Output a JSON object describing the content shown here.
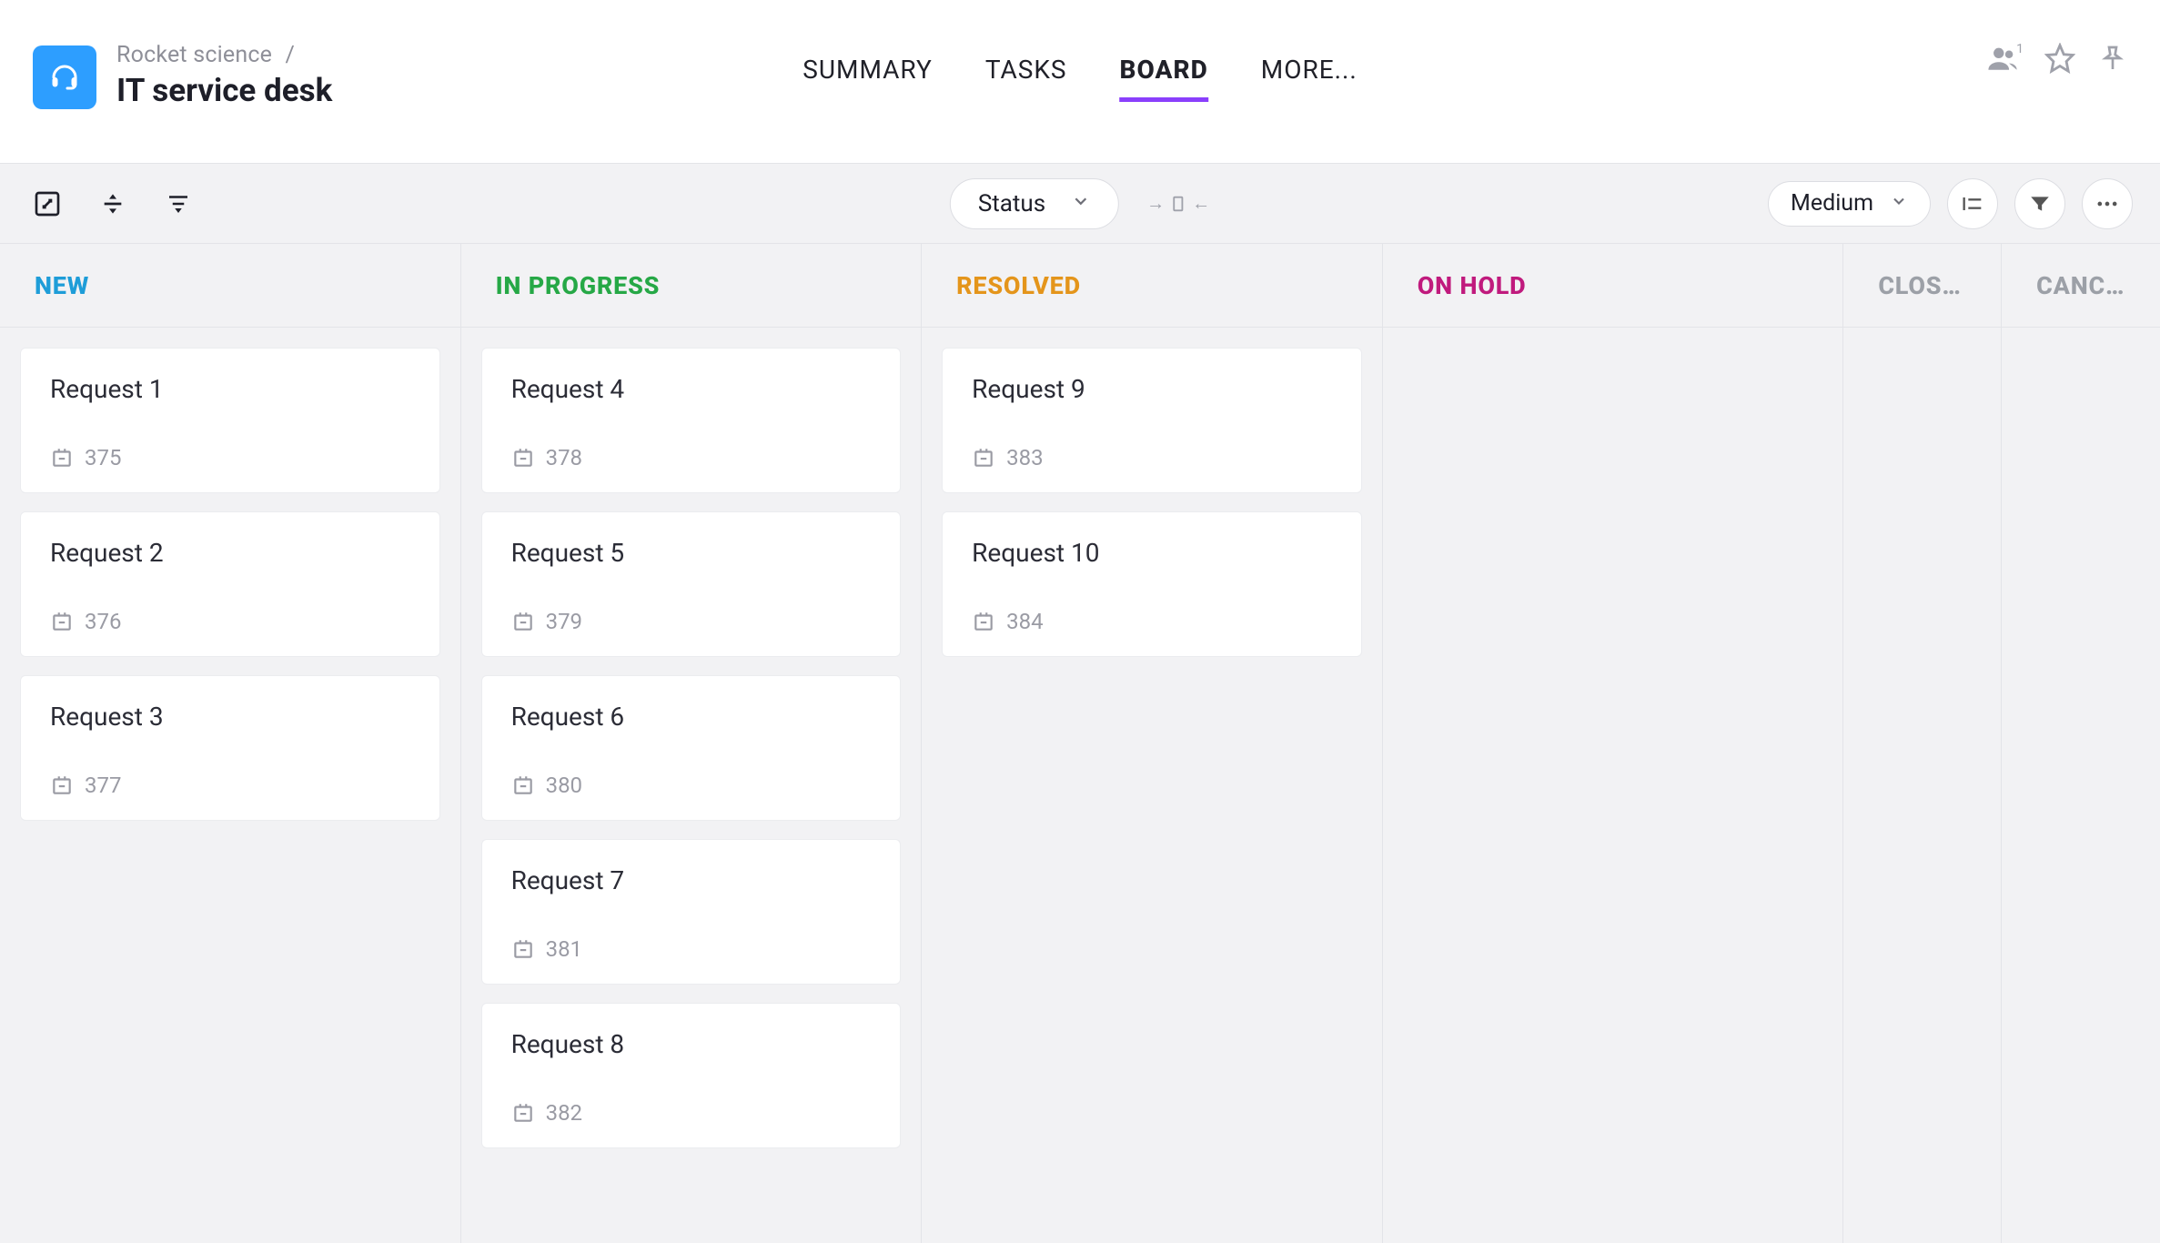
{
  "breadcrumb": {
    "parent": "Rocket science",
    "sep": "/"
  },
  "title": "IT service desk",
  "tabs": {
    "summary": "SUMMARY",
    "tasks": "TASKS",
    "board": "BOARD",
    "more": "MORE..."
  },
  "active_tab": "board",
  "header_actions": {
    "members_count": "1"
  },
  "toolbar": {
    "group_by": "Status",
    "size": "Medium"
  },
  "columns": [
    {
      "key": "new",
      "label": "NEW",
      "colorClass": "c-new",
      "widthClass": "w-big"
    },
    {
      "key": "inprog",
      "label": "IN PROGRESS",
      "colorClass": "c-inprog",
      "widthClass": "w-big"
    },
    {
      "key": "resolved",
      "label": "RESOLVED",
      "colorClass": "c-resolved",
      "widthClass": "w-big"
    },
    {
      "key": "onhold",
      "label": "ON HOLD",
      "colorClass": "c-onhold",
      "widthClass": "w-big"
    },
    {
      "key": "closed",
      "label": "CLOS…",
      "colorClass": "c-closed",
      "widthClass": "w-narrow"
    },
    {
      "key": "cancelled",
      "label": "CANC…",
      "colorClass": "c-cancel",
      "widthClass": "w-narrow"
    }
  ],
  "cards": {
    "new": [
      {
        "title": "Request 1",
        "id": "375"
      },
      {
        "title": "Request 2",
        "id": "376"
      },
      {
        "title": "Request 3",
        "id": "377"
      }
    ],
    "inprog": [
      {
        "title": "Request 4",
        "id": "378"
      },
      {
        "title": "Request 5",
        "id": "379"
      },
      {
        "title": "Request 6",
        "id": "380"
      },
      {
        "title": "Request 7",
        "id": "381"
      },
      {
        "title": "Request 8",
        "id": "382"
      }
    ],
    "resolved": [
      {
        "title": "Request 9",
        "id": "383"
      },
      {
        "title": "Request 10",
        "id": "384"
      }
    ],
    "onhold": [],
    "closed": [],
    "cancelled": []
  }
}
